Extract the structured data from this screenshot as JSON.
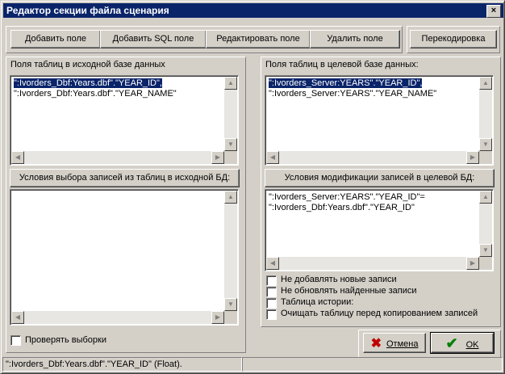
{
  "window": {
    "title": "Редактор секции файла сценария",
    "close_glyph": "×"
  },
  "toolbar": {
    "add_field": "Добавить поле",
    "add_sql_field": "Добавить SQL поле",
    "edit_field": "Редактировать поле",
    "delete_field": "Удалить поле",
    "recode": "Перекодировка"
  },
  "source": {
    "fields_label": "Поля таблиц в исходной базе данных",
    "fields": [
      "\":Ivorders_Dbf:Years.dbf\".\"YEAR_ID\",",
      "\":Ivorders_Dbf:Years.dbf\".\"YEAR_NAME\""
    ],
    "selected_index": 0,
    "conditions_button": "Условия выбора записей из таблиц в исходной БД:",
    "conditions_text": []
  },
  "target": {
    "fields_label": "Поля таблиц в целевой базе данных:",
    "fields": [
      "\":Ivorders_Server:YEARS\".\"YEAR_ID\",",
      "\":Ivorders_Server:YEARS\".\"YEAR_NAME\""
    ],
    "selected_index": 0,
    "conditions_button": "Условия модификации записей в целевой БД:",
    "conditions_text": [
      "\":Ivorders_Server:YEARS\".\"YEAR_ID\"=",
      "\":Ivorders_Dbf:Years.dbf\".\"YEAR_ID\""
    ]
  },
  "options": {
    "no_add_new": {
      "label": "Не добавлять новые записи",
      "checked": false
    },
    "no_update_found": {
      "label": "Не обновлять найденные записи",
      "checked": false
    },
    "history_table": {
      "label": "Таблица истории:",
      "checked": false
    },
    "clear_table": {
      "label": "Очищать таблицу перед копированием записей",
      "checked": false
    },
    "check_selections": {
      "label": "Проверять выборки",
      "checked": false
    }
  },
  "actions": {
    "cancel_label": "Отмена",
    "ok_label": "OK"
  },
  "status_bar": {
    "text": "\":Ivorders_Dbf:Years.dbf\".\"YEAR_ID\" (Float)."
  },
  "colors": {
    "titlebar": "#0a246a",
    "face": "#d4d0c8",
    "selection": "#0a246a",
    "cancel_icon": "#c00000",
    "ok_icon": "#008000"
  },
  "icons": {
    "cancel": "x-icon",
    "ok": "check-icon"
  }
}
